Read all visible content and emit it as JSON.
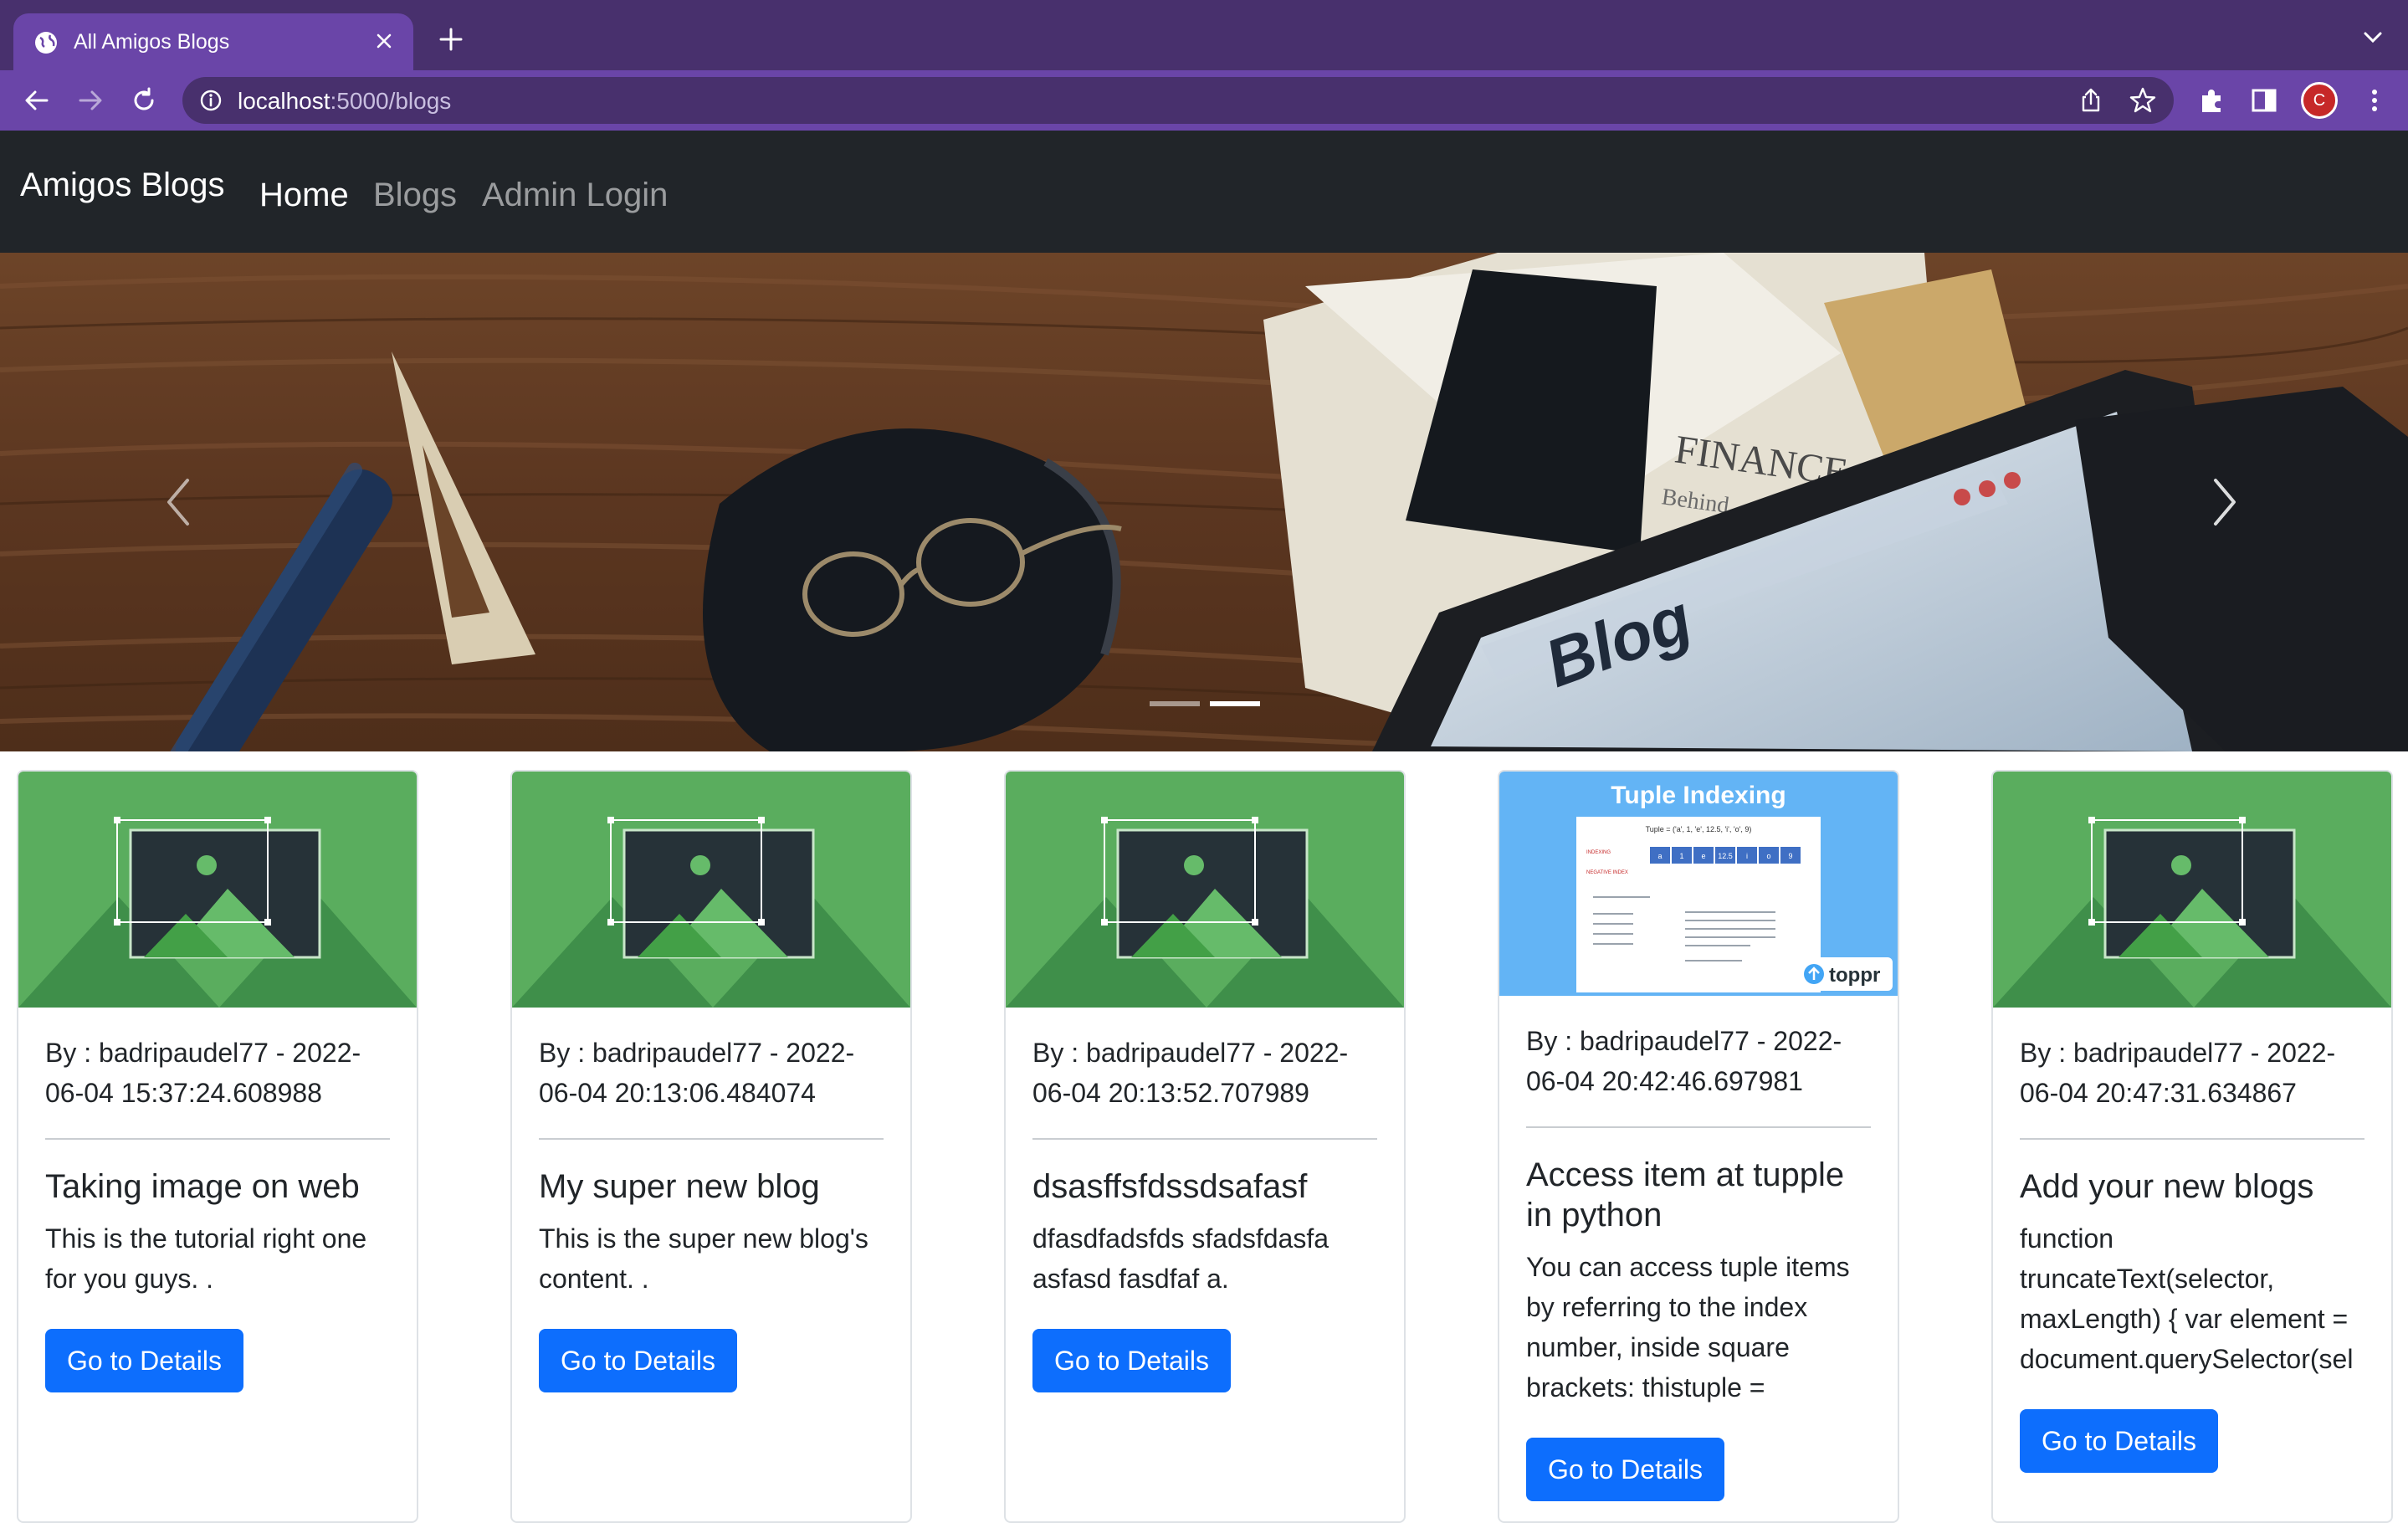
{
  "browser": {
    "tab_title": "All Amigos Blogs",
    "url_host": "localhost",
    "url_rest": ":5000/blogs",
    "profile_initial": "C"
  },
  "site": {
    "brand": "Amigos Blogs",
    "nav": [
      "Home",
      "Blogs",
      "Admin Login"
    ],
    "active_nav": "Home"
  },
  "hero": {
    "slide_count": 2,
    "active_slide": 2,
    "laptop_text": "Blog",
    "newspaper_text": "FINANCE",
    "newspaper_text2": "Behind"
  },
  "cards": [
    {
      "meta": "By : badripaudel77 - 2022-06-04 15:37:24.608988",
      "title": "Taking image on web",
      "text": "This is the tutorial right one for you guys. .",
      "button": "Go to Details",
      "image": "placeholder-image"
    },
    {
      "meta": "By : badripaudel77 - 2022-06-04 20:13:06.484074",
      "title": "My super new blog",
      "text": "This is the super new blog's content. .",
      "button": "Go to Details",
      "image": "placeholder-image"
    },
    {
      "meta": "By : badripaudel77 - 2022-06-04 20:13:52.707989",
      "title": "dsasffsfdssdsafasf",
      "text": "dfasdfadsfds sfadsfdasfa asfasd fasdfaf a.",
      "button": "Go to Details",
      "image": "placeholder-image"
    },
    {
      "meta": "By : badripaudel77 - 2022-06-04 20:42:46.697981",
      "title": "Access item at tupple in python",
      "text": "You can access tuple items by referring to the index number, inside square brackets: thistuple =",
      "button": "Go to Details",
      "image": "tuple-indexing-image",
      "image_title": "Tuple Indexing",
      "image_code": "Tuple = ('a', 1, 'e', 12.5, 'i', 'o', 9)",
      "image_cells": [
        "a",
        "1",
        "e",
        "12.5",
        "i",
        "o",
        "9"
      ],
      "image_row_labels": [
        "INDEXING",
        "NEGATIVE INDEX"
      ],
      "image_brand": "toppr"
    },
    {
      "meta": "By : badripaudel77 - 2022-06-04 20:47:31.634867",
      "title": "Add your new blogs",
      "text": "function truncateText(selector, maxLength) { var element = document.querySelector(sel",
      "button": "Go to Details",
      "image": "placeholder-image"
    }
  ],
  "colors": {
    "browser_frame": "#48306d",
    "browser_toolbar": "#6a45a8",
    "navbar": "#212529",
    "primary_button": "#0d6efd",
    "placeholder_green": "#5aad5e"
  }
}
